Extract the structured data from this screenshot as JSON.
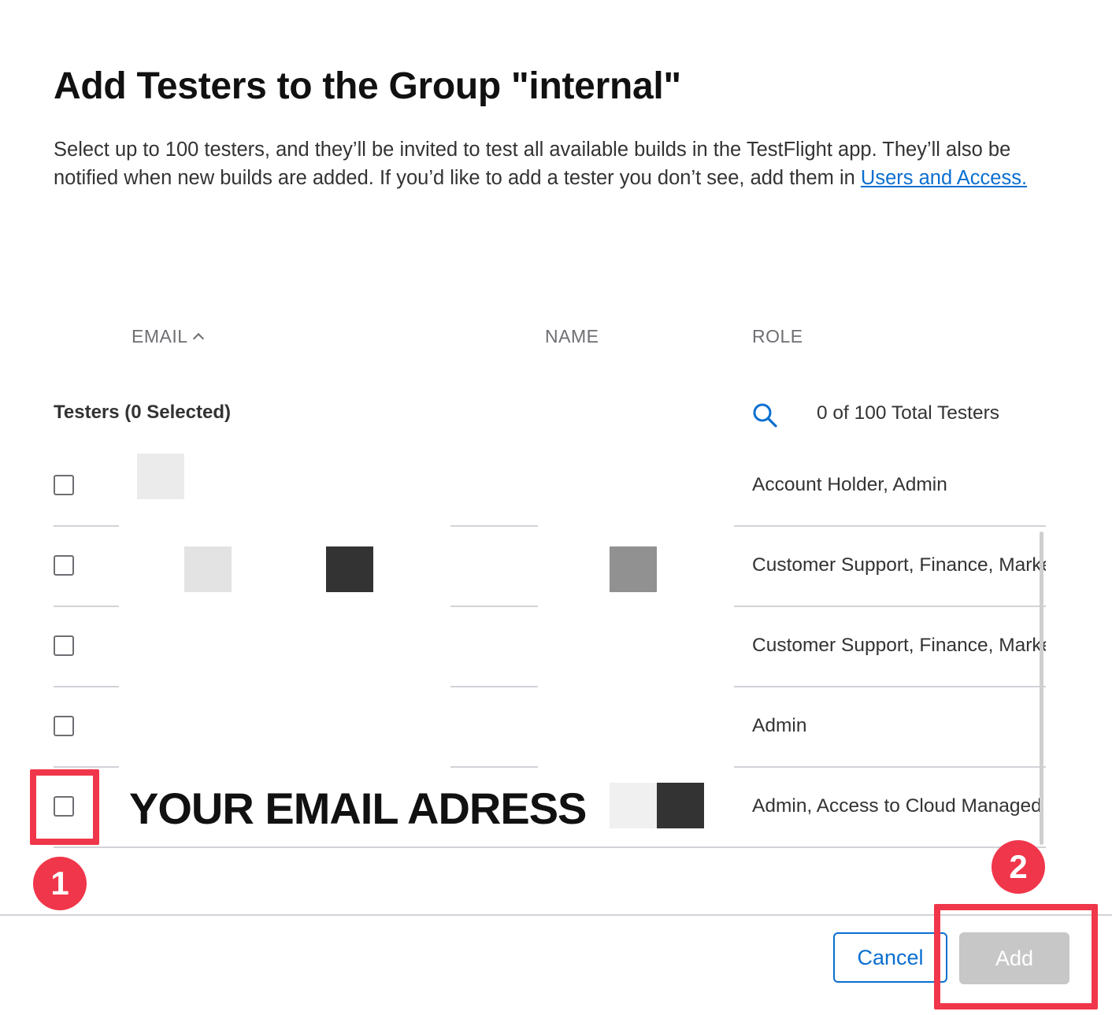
{
  "dialog": {
    "title": "Add Testers to the Group \"internal\"",
    "description": "Select up to 100 testers, and they’ll be invited to test all available builds in the TestFlight app. They’ll also be notified when new builds are added. If you’d like to add a tester you don’t see, add them in ",
    "link_text": "Users and Access."
  },
  "table": {
    "columns": {
      "email": "EMAIL",
      "name": "NAME",
      "role": "ROLE"
    },
    "sort_indicator": "caret-up-icon",
    "testers_label": "Testers (0 Selected)",
    "total_label": "0 of 100 Total Testers",
    "rows": [
      {
        "checked": false,
        "role": "Account Holder, Admin"
      },
      {
        "checked": false,
        "role": "Customer Support, Finance, Marketing"
      },
      {
        "checked": false,
        "role": "Customer Support, Finance, Marketing"
      },
      {
        "checked": false,
        "role": "Admin"
      },
      {
        "checked": false,
        "role": "Admin, Access to Cloud Managed"
      }
    ]
  },
  "annotations": {
    "email_overlay": "YOUR EMAIL ADRESS",
    "badge1": "1",
    "badge2": "2",
    "highlight_color": "#f0364a"
  },
  "footer": {
    "cancel_label": "Cancel",
    "add_label": "Add"
  },
  "colors": {
    "link": "#0a6fd0",
    "add_disabled": "#c7c7c7"
  }
}
